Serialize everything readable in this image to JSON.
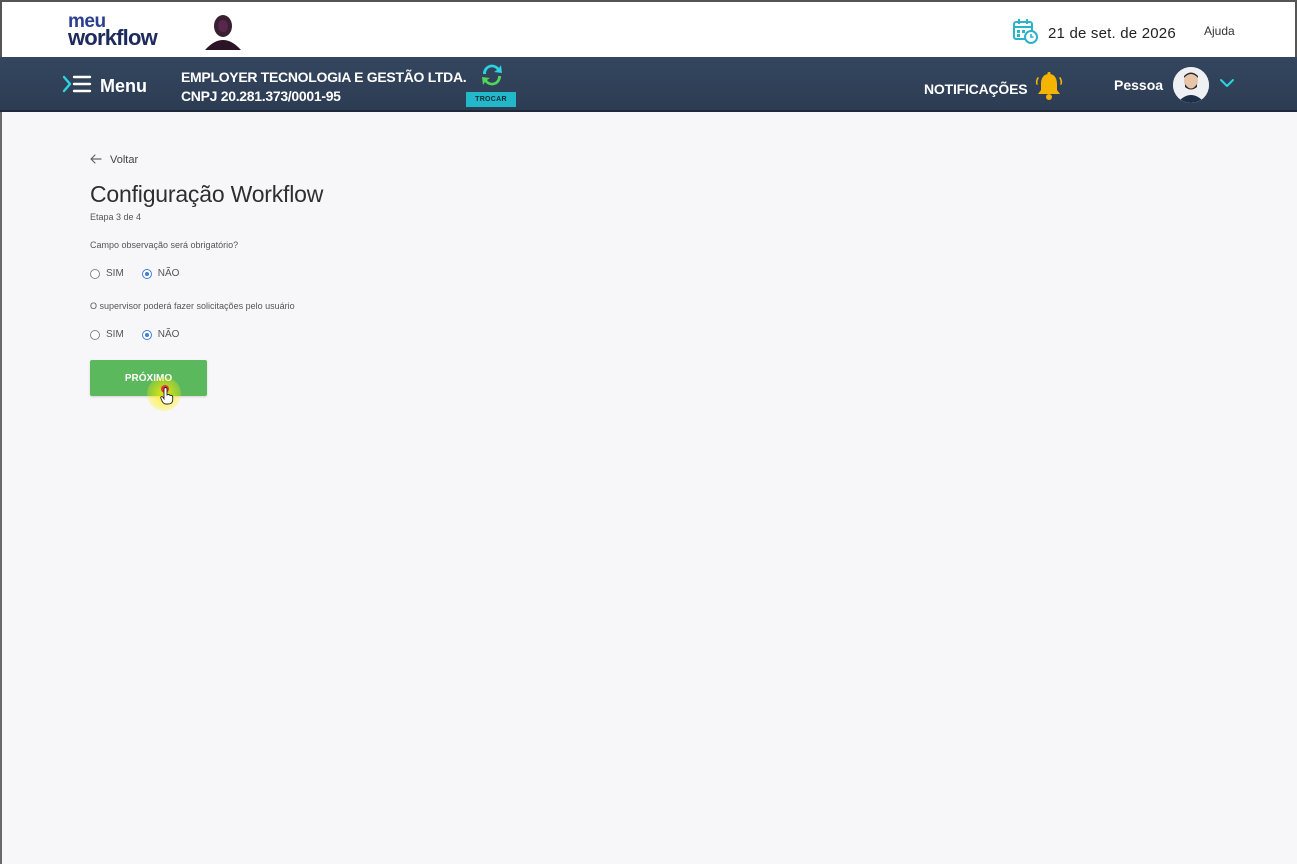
{
  "header": {
    "logo_top": "meu",
    "logo_bottom": "workflow",
    "date": "21 de set. de 2026",
    "help": "Ajuda"
  },
  "navbar": {
    "menu_label": "Menu",
    "company_name": "EMPLOYER TECNOLOGIA E GESTÃO LTDA.",
    "company_cnpj": "CNPJ 20.281.373/0001-95",
    "switch_label": "TROCAR",
    "notifications_label": "NOTIFICAÇÕES",
    "user_label": "Pessoa"
  },
  "content": {
    "back_label": "Voltar",
    "title": "Configuração Workflow",
    "step": "Etapa 3 de 4",
    "questions": [
      {
        "text": "Campo observação será obrigatório?",
        "options": [
          {
            "label": "SIM",
            "checked": false
          },
          {
            "label": "NÃO",
            "checked": true
          }
        ]
      },
      {
        "text": "O supervisor poderá fazer solicitações pelo usuário",
        "options": [
          {
            "label": "SIM",
            "checked": false
          },
          {
            "label": "NÃO",
            "checked": true
          }
        ]
      }
    ],
    "next_label": "PRÓXIMO"
  },
  "colors": {
    "navbar": "#2f4058",
    "primary_button": "#5cb85c",
    "radio_selected": "#3f7fd4",
    "badge": "#22b7c9",
    "bell": "#f4b400"
  },
  "icons": [
    "calendar-clock-icon",
    "menu-icon",
    "refresh-icon",
    "bell-icon",
    "chevron-down-icon",
    "arrow-left-icon",
    "hand-pointer-icon"
  ]
}
